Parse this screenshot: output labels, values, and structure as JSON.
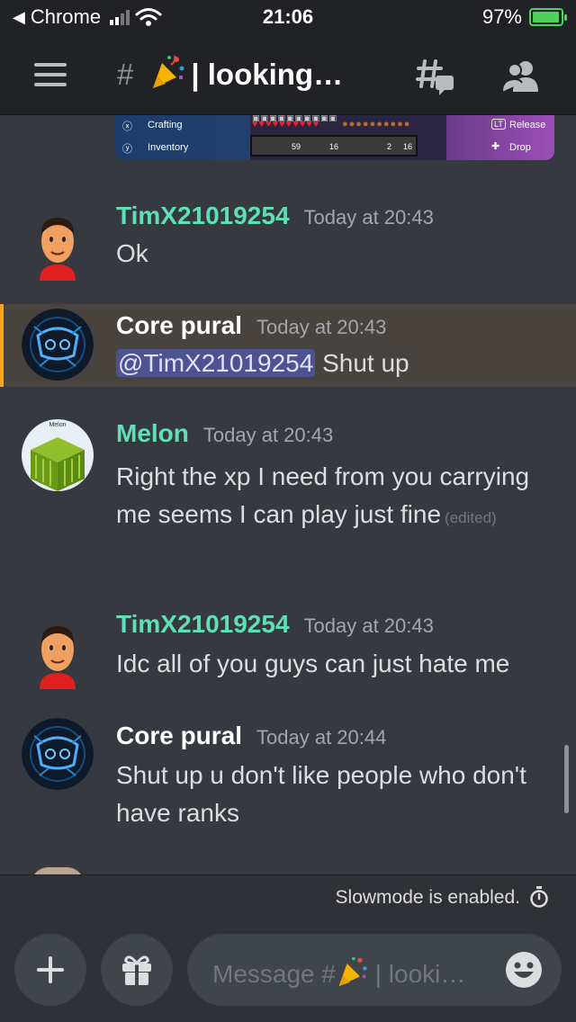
{
  "status_bar": {
    "back_app": "Chrome",
    "time": "21:06",
    "battery": "97%"
  },
  "header": {
    "hash": "#",
    "channel_name": "| looking…"
  },
  "game_strip": {
    "crafting": "Crafting",
    "inventory": "Inventory",
    "release": "Release",
    "drop": "Drop",
    "lt": "LT",
    "counts": [
      "59",
      "16",
      "2",
      "16"
    ]
  },
  "messages": [
    {
      "author": "TimX21019254",
      "time": "Today at 20:43",
      "text": "Ok"
    },
    {
      "author": "Core pural",
      "time": "Today at 20:43",
      "mention": "@TimX21019254",
      "text": " Shut up"
    },
    {
      "author": "Melon",
      "avatar_label": "Melon",
      "time": "Today at 20:43",
      "text": "Right the xp I need from you carrying me seems I can play just fine",
      "edited": "(edited)"
    },
    {
      "author": "TimX21019254",
      "time": "Today at 20:43",
      "text": "Idc all of you guys can just hate me"
    },
    {
      "author": "Core pural",
      "time": "Today at 20:44",
      "text": "Shut up u don't like people who don't have ranks"
    }
  ],
  "slowmode": {
    "text": "Slowmode is enabled."
  },
  "input": {
    "placeholder_prefix": "Message #",
    "placeholder_suffix": " | looki…"
  },
  "colors": {
    "username_green": "#5fe0b4",
    "mention_bg": "#4d5290",
    "highlight_bar": "#faa61a"
  }
}
